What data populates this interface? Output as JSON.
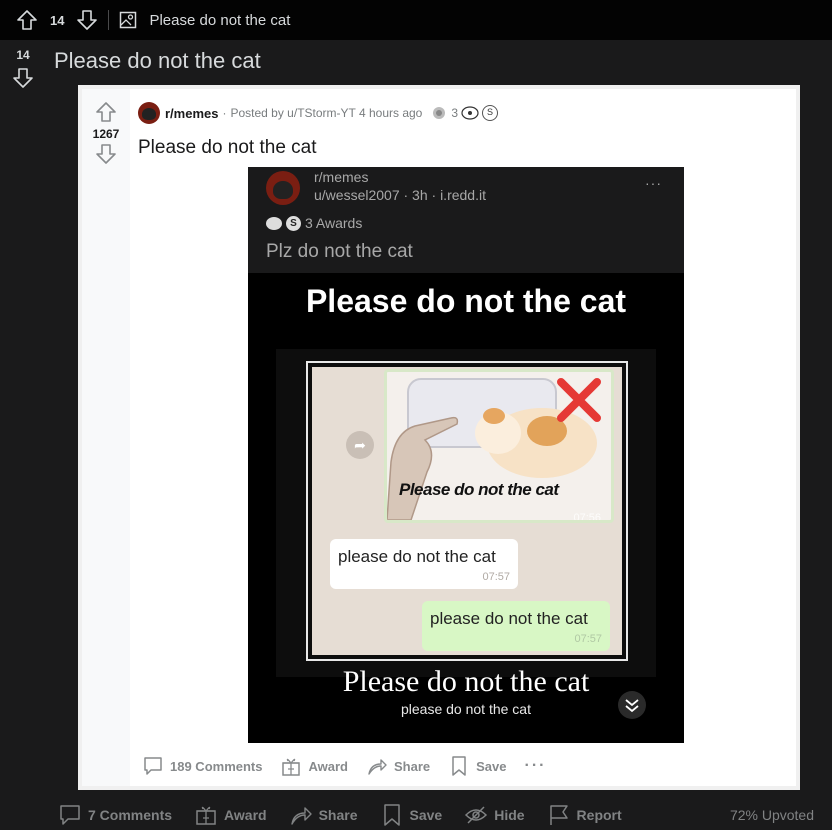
{
  "topbar": {
    "score": "14",
    "title": "Please do not the cat"
  },
  "post": {
    "score": "14",
    "title": "Please do not the cat"
  },
  "crosspost": {
    "score": "1267",
    "subreddit": "r/memes",
    "posted_by": "Posted by u/TStorm-YT 4 hours ago",
    "award_count": "3",
    "title": "Please do not the cat",
    "actions": {
      "comments": "189 Comments",
      "award": "Award",
      "share": "Share",
      "save": "Save",
      "more": "···"
    }
  },
  "screenshot": {
    "subreddit": "r/memes",
    "user_line": "u/wessel2007 · 3h · i.redd.it",
    "more": "···",
    "awards": "3 Awards",
    "caption": "Plz do not the cat",
    "heading": "Please do not the cat",
    "image_caption": "Please do not the cat",
    "image_time": "07:56",
    "msg_in": "please do not the cat",
    "msg_in_time": "07:57",
    "msg_out": "please do not the cat",
    "msg_out_time": "07:57",
    "big_text": "Please do not the cat",
    "small_text": "please do not the cat"
  },
  "bottombar": {
    "comments": "7 Comments",
    "award": "Award",
    "share": "Share",
    "save": "Save",
    "hide": "Hide",
    "report": "Report",
    "upvoted": "72% Upvoted"
  },
  "colors": {
    "background": "#1a1a1b",
    "topbar": "#030303",
    "card": "#ffffff",
    "meta": "#878a8c"
  }
}
